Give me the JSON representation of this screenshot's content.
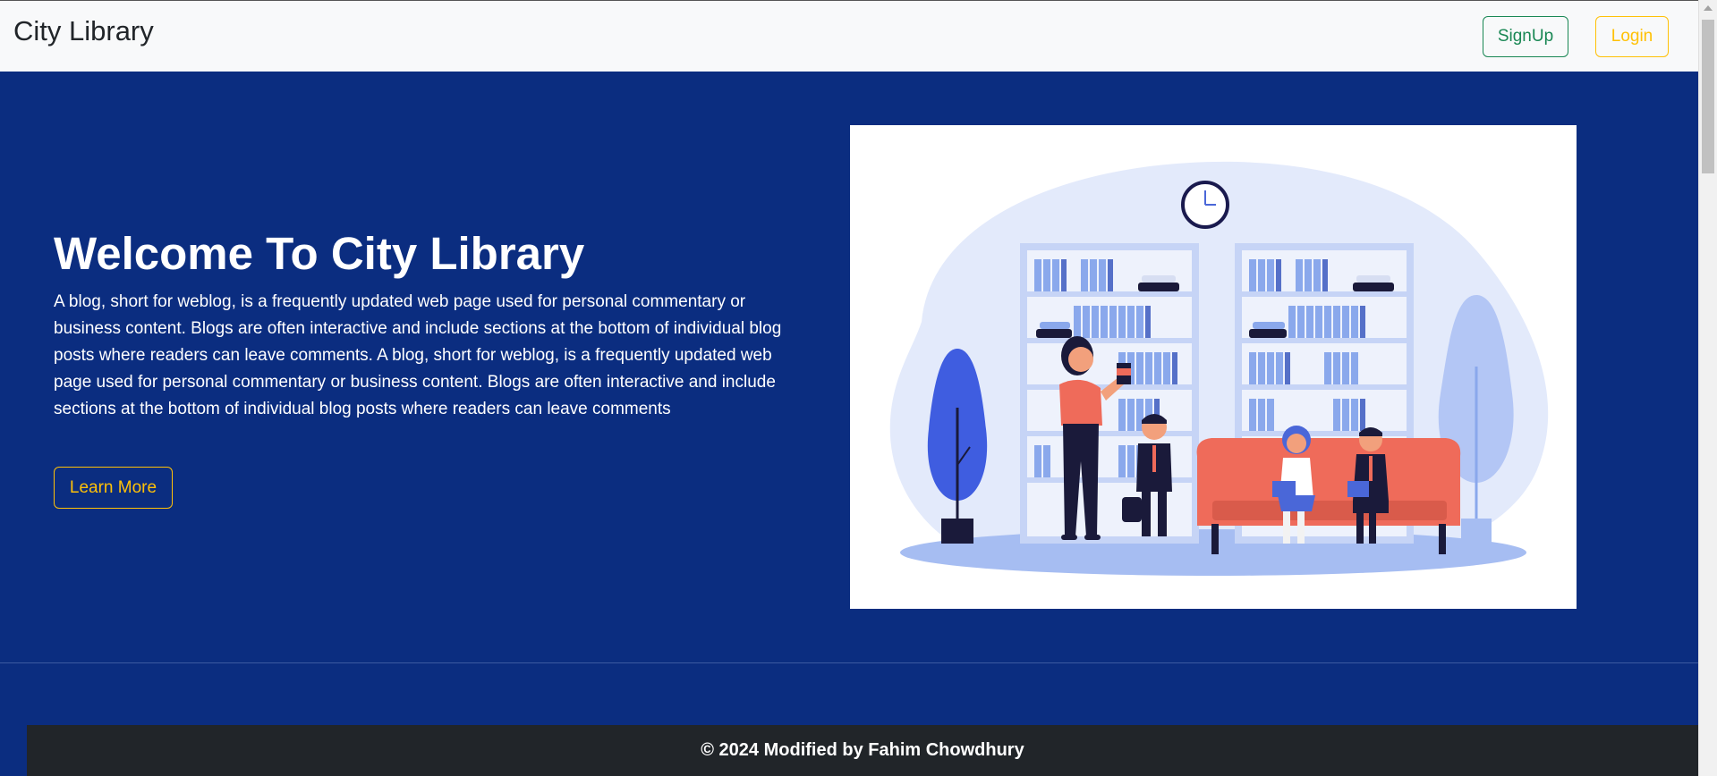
{
  "navbar": {
    "brand": "City Library",
    "signup_label": "SignUp",
    "login_label": "Login"
  },
  "hero": {
    "title": "Welcome To City Library",
    "description": "A blog, short for weblog, is a frequently updated web page used for personal commentary or business content. Blogs are often interactive and include sections at the bottom of individual blog posts where readers can leave comments. A blog, short for weblog, is a frequently updated web page used for personal commentary or business content. Blogs are often interactive and include sections at the bottom of individual blog posts where readers can leave comments",
    "button_label": "Learn More",
    "illustration": "library-illustration"
  },
  "footer": {
    "text": "© 2024 Modified by Fahim Chowdhury"
  },
  "colors": {
    "navbar_bg": "#f8f9fa",
    "hero_bg": "#0b2d80",
    "signup_accent": "#198754",
    "warning_accent": "#ffc107",
    "footer_bg": "#212529"
  }
}
